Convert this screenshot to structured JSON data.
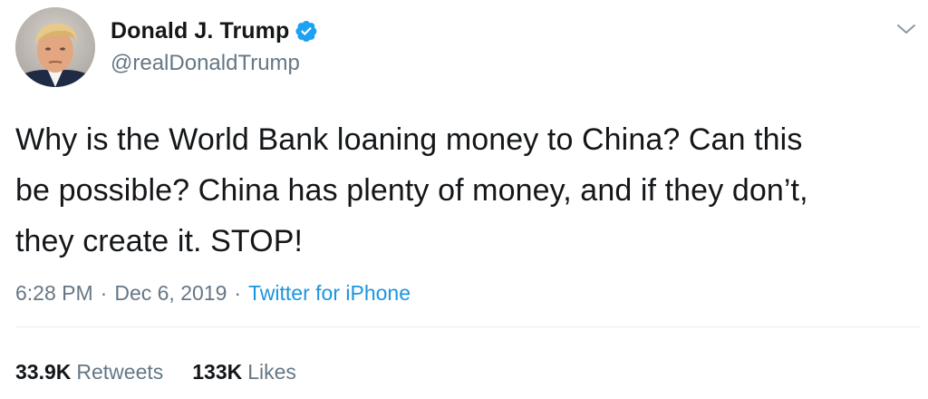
{
  "author": {
    "display_name": "Donald J. Trump",
    "handle": "@realDonaldTrump",
    "verified": true,
    "avatar_icon": "profile-photo"
  },
  "tweet": {
    "text_lines": [
      "Why is the World Bank loaning money to China? Can this",
      "be possible? China has plenty of money, and if they don’t,",
      "they create it. STOP!"
    ]
  },
  "meta": {
    "time": "6:28 PM",
    "separator": "·",
    "date": "Dec 6, 2019",
    "source": "Twitter for iPhone"
  },
  "stats": {
    "retweets_count": "33.9K",
    "retweets_label": "Retweets",
    "likes_count": "133K",
    "likes_label": "Likes"
  },
  "colors": {
    "text": "#14171a",
    "secondary": "#657786",
    "accent": "#1b95e0",
    "verified": "#1da1f2",
    "divider": "#e6ecf0"
  },
  "icons": {
    "verified": "verified-badge-icon",
    "menu": "chevron-down-icon"
  }
}
